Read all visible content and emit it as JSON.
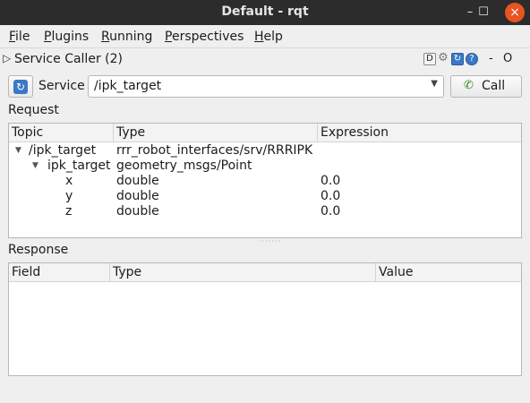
{
  "window": {
    "title": "Default - rqt",
    "controls": {
      "minimize": "–",
      "maximize": "☐",
      "close": "×"
    }
  },
  "menubar": {
    "items": [
      {
        "first": "F",
        "rest": "ile"
      },
      {
        "first": "P",
        "rest": "lugins"
      },
      {
        "first": "R",
        "rest": "unning"
      },
      {
        "first": "P",
        "rest": "erspectives"
      },
      {
        "first": "H",
        "rest": "elp"
      }
    ]
  },
  "plugin": {
    "title": "Service Caller (2)",
    "header_icons": {
      "dock": "D",
      "settings": "⚙",
      "reload": "↻",
      "help": "?"
    },
    "header_text": {
      "minimize": "-",
      "close": "O"
    }
  },
  "service_row": {
    "label": "Service",
    "selected_service": "/ipk_target",
    "call_label": "Call",
    "icons": {
      "refresh": "↻",
      "call": "✆",
      "dropdown": "▼"
    }
  },
  "request": {
    "label": "Request",
    "columns": [
      "Topic",
      "Type",
      "Expression"
    ],
    "rows": [
      {
        "topic": "/ipk_target",
        "type": "rrr_robot_interfaces/srv/RRRIPK",
        "expression": ""
      },
      {
        "topic": "ipk_target",
        "type": "geometry_msgs/Point",
        "expression": ""
      },
      {
        "topic": "x",
        "type": "double",
        "expression": "0.0"
      },
      {
        "topic": "y",
        "type": "double",
        "expression": "0.0"
      },
      {
        "topic": "z",
        "type": "double",
        "expression": "0.0"
      }
    ],
    "expander_icon": "▼"
  },
  "response": {
    "label": "Response",
    "columns": [
      "Field",
      "Type",
      "Value"
    ]
  }
}
